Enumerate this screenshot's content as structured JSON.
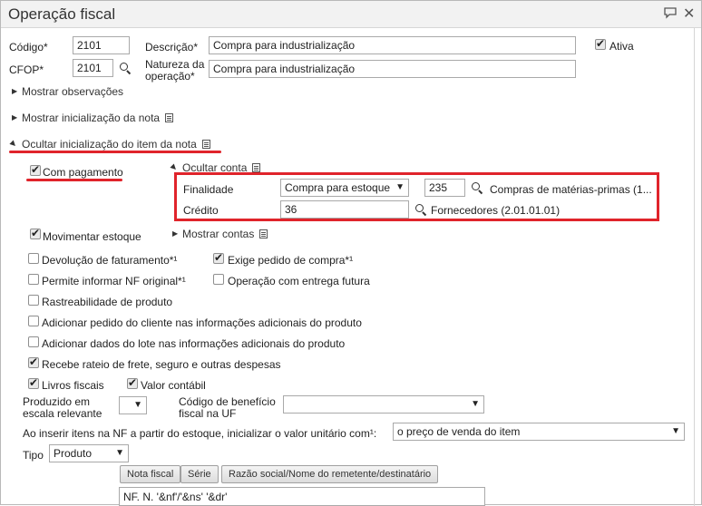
{
  "window": {
    "title": "Operação fiscal"
  },
  "header_form": {
    "codigo_label": "Código*",
    "codigo_value": "2101",
    "cfop_label": "CFOP*",
    "cfop_value": "2101",
    "descricao_label": "Descrição*",
    "descricao_value": "Compra para industrialização",
    "natureza_label_1": "Natureza da",
    "natureza_label_2": "operação*",
    "natureza_value": "Compra para industrialização",
    "ativa_label": "Ativa",
    "ativa_checked": true
  },
  "sections": {
    "mostrar_observacoes": "Mostrar observações",
    "mostrar_inicializacao_nota": "Mostrar inicialização da nota",
    "ocultar_inicializacao_item": "Ocultar inicialização do item da nota"
  },
  "item_init": {
    "com_pagamento_label": "Com pagamento",
    "ocultar_conta_label": "Ocultar conta",
    "finalidade_label": "Finalidade",
    "finalidade_value": "Compra para estoque",
    "finalidade_code": "235",
    "finalidade_desc": "Compras de matérias-primas (1...",
    "credito_label": "Crédito",
    "credito_value": "36",
    "credito_desc": "Fornecedores (2.01.01.01)",
    "movimentar_estoque_label": "Movimentar estoque",
    "mostrar_contas_label": "Mostrar contas"
  },
  "options": {
    "devolucao": "Devolução de faturamento*¹",
    "exige_pedido": "Exige pedido de compra*¹",
    "permite_nf": "Permite informar NF original*¹",
    "entrega_futura": "Operação com entrega futura",
    "rastreabilidade": "Rastreabilidade de produto",
    "adicionar_pedido": "Adicionar pedido do cliente nas informações adicionais do produto",
    "adicionar_lote": "Adicionar dados do lote nas informações adicionais do produto",
    "recebe_rateio": "Recebe rateio de frete, seguro e outras despesas",
    "livros_fiscais": "Livros fiscais",
    "valor_contabil": "Valor contábil"
  },
  "extra": {
    "produzido_label_1": "Produzido em",
    "produzido_label_2": "escala relevante",
    "codigo_beneficio_label_1": "Código de benefício",
    "codigo_beneficio_label_2": "fiscal na UF",
    "inserir_label": "Ao inserir itens na NF a partir do estoque, inicializar o valor unitário com¹:",
    "inserir_value": "o preço de venda do item",
    "tipo_label": "Tipo",
    "tipo_value": "Produto"
  },
  "buttons": {
    "nota_fiscal": "Nota fiscal",
    "serie": "Série",
    "razao_social": "Razão social/Nome do remetente/destinatário"
  },
  "textarea_value": "NF. N. '&nf'/'&ns' '&dr'",
  "colors": {
    "highlight": "#e0242b"
  }
}
